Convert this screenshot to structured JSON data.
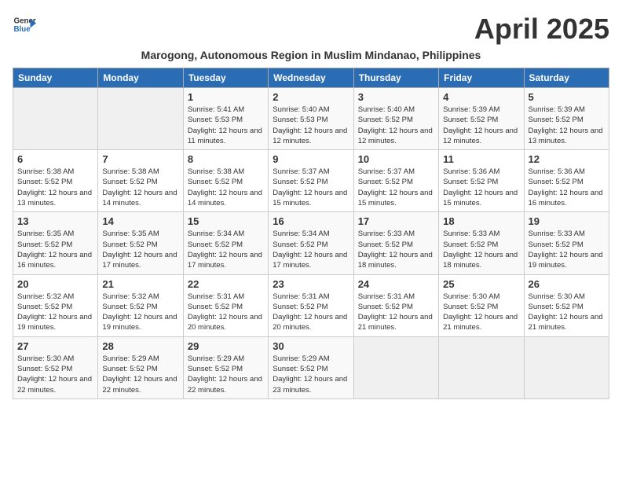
{
  "logo": {
    "line1": "General",
    "line2": "Blue"
  },
  "title": "April 2025",
  "subtitle": "Marogong, Autonomous Region in Muslim Mindanao, Philippines",
  "days_header": [
    "Sunday",
    "Monday",
    "Tuesday",
    "Wednesday",
    "Thursday",
    "Friday",
    "Saturday"
  ],
  "weeks": [
    [
      {
        "day": "",
        "info": ""
      },
      {
        "day": "",
        "info": ""
      },
      {
        "day": "1",
        "info": "Sunrise: 5:41 AM\nSunset: 5:53 PM\nDaylight: 12 hours and 11 minutes."
      },
      {
        "day": "2",
        "info": "Sunrise: 5:40 AM\nSunset: 5:53 PM\nDaylight: 12 hours and 12 minutes."
      },
      {
        "day": "3",
        "info": "Sunrise: 5:40 AM\nSunset: 5:52 PM\nDaylight: 12 hours and 12 minutes."
      },
      {
        "day": "4",
        "info": "Sunrise: 5:39 AM\nSunset: 5:52 PM\nDaylight: 12 hours and 12 minutes."
      },
      {
        "day": "5",
        "info": "Sunrise: 5:39 AM\nSunset: 5:52 PM\nDaylight: 12 hours and 13 minutes."
      }
    ],
    [
      {
        "day": "6",
        "info": "Sunrise: 5:38 AM\nSunset: 5:52 PM\nDaylight: 12 hours and 13 minutes."
      },
      {
        "day": "7",
        "info": "Sunrise: 5:38 AM\nSunset: 5:52 PM\nDaylight: 12 hours and 14 minutes."
      },
      {
        "day": "8",
        "info": "Sunrise: 5:38 AM\nSunset: 5:52 PM\nDaylight: 12 hours and 14 minutes."
      },
      {
        "day": "9",
        "info": "Sunrise: 5:37 AM\nSunset: 5:52 PM\nDaylight: 12 hours and 15 minutes."
      },
      {
        "day": "10",
        "info": "Sunrise: 5:37 AM\nSunset: 5:52 PM\nDaylight: 12 hours and 15 minutes."
      },
      {
        "day": "11",
        "info": "Sunrise: 5:36 AM\nSunset: 5:52 PM\nDaylight: 12 hours and 15 minutes."
      },
      {
        "day": "12",
        "info": "Sunrise: 5:36 AM\nSunset: 5:52 PM\nDaylight: 12 hours and 16 minutes."
      }
    ],
    [
      {
        "day": "13",
        "info": "Sunrise: 5:35 AM\nSunset: 5:52 PM\nDaylight: 12 hours and 16 minutes."
      },
      {
        "day": "14",
        "info": "Sunrise: 5:35 AM\nSunset: 5:52 PM\nDaylight: 12 hours and 17 minutes."
      },
      {
        "day": "15",
        "info": "Sunrise: 5:34 AM\nSunset: 5:52 PM\nDaylight: 12 hours and 17 minutes."
      },
      {
        "day": "16",
        "info": "Sunrise: 5:34 AM\nSunset: 5:52 PM\nDaylight: 12 hours and 17 minutes."
      },
      {
        "day": "17",
        "info": "Sunrise: 5:33 AM\nSunset: 5:52 PM\nDaylight: 12 hours and 18 minutes."
      },
      {
        "day": "18",
        "info": "Sunrise: 5:33 AM\nSunset: 5:52 PM\nDaylight: 12 hours and 18 minutes."
      },
      {
        "day": "19",
        "info": "Sunrise: 5:33 AM\nSunset: 5:52 PM\nDaylight: 12 hours and 19 minutes."
      }
    ],
    [
      {
        "day": "20",
        "info": "Sunrise: 5:32 AM\nSunset: 5:52 PM\nDaylight: 12 hours and 19 minutes."
      },
      {
        "day": "21",
        "info": "Sunrise: 5:32 AM\nSunset: 5:52 PM\nDaylight: 12 hours and 19 minutes."
      },
      {
        "day": "22",
        "info": "Sunrise: 5:31 AM\nSunset: 5:52 PM\nDaylight: 12 hours and 20 minutes."
      },
      {
        "day": "23",
        "info": "Sunrise: 5:31 AM\nSunset: 5:52 PM\nDaylight: 12 hours and 20 minutes."
      },
      {
        "day": "24",
        "info": "Sunrise: 5:31 AM\nSunset: 5:52 PM\nDaylight: 12 hours and 21 minutes."
      },
      {
        "day": "25",
        "info": "Sunrise: 5:30 AM\nSunset: 5:52 PM\nDaylight: 12 hours and 21 minutes."
      },
      {
        "day": "26",
        "info": "Sunrise: 5:30 AM\nSunset: 5:52 PM\nDaylight: 12 hours and 21 minutes."
      }
    ],
    [
      {
        "day": "27",
        "info": "Sunrise: 5:30 AM\nSunset: 5:52 PM\nDaylight: 12 hours and 22 minutes."
      },
      {
        "day": "28",
        "info": "Sunrise: 5:29 AM\nSunset: 5:52 PM\nDaylight: 12 hours and 22 minutes."
      },
      {
        "day": "29",
        "info": "Sunrise: 5:29 AM\nSunset: 5:52 PM\nDaylight: 12 hours and 22 minutes."
      },
      {
        "day": "30",
        "info": "Sunrise: 5:29 AM\nSunset: 5:52 PM\nDaylight: 12 hours and 23 minutes."
      },
      {
        "day": "",
        "info": ""
      },
      {
        "day": "",
        "info": ""
      },
      {
        "day": "",
        "info": ""
      }
    ]
  ]
}
